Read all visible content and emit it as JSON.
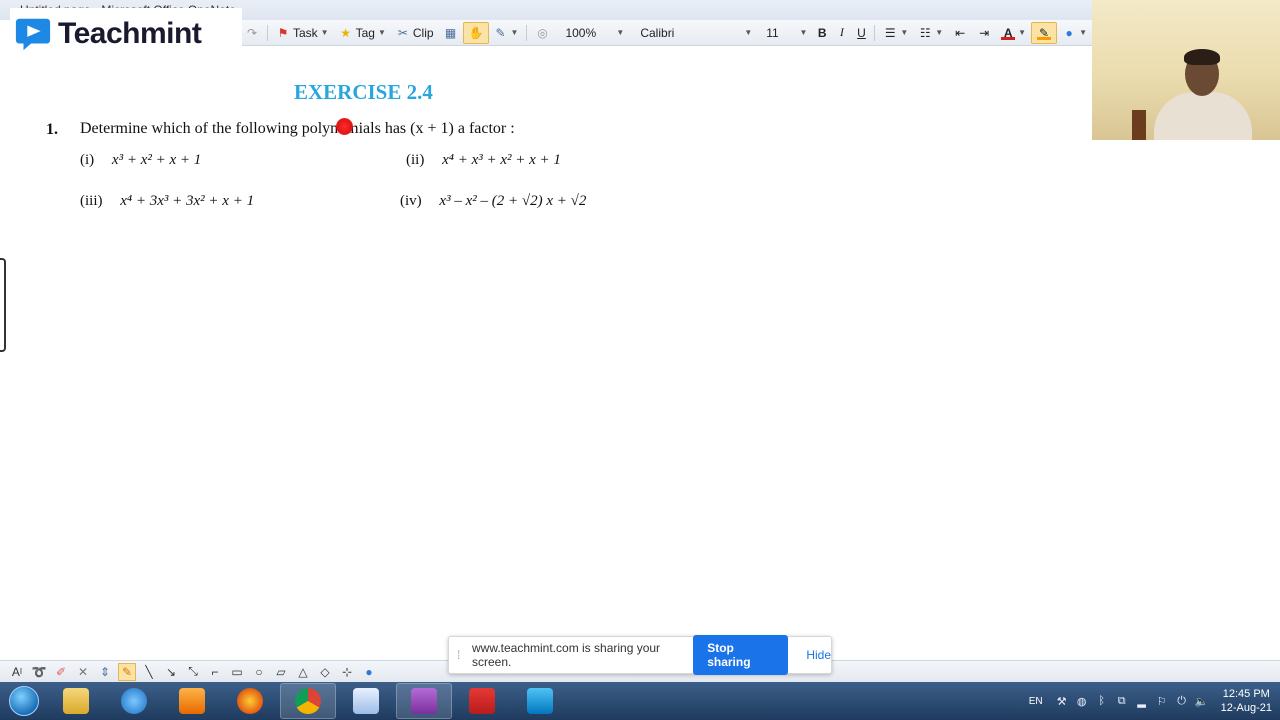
{
  "window": {
    "title": "Untitled page - Microsoft Office OneNote"
  },
  "logo": {
    "text": "Teachmint"
  },
  "toolbar": {
    "task_label": "Task",
    "tag_label": "Tag",
    "clip_label": "Clip",
    "zoom": "100%",
    "font_name": "Calibri",
    "font_size": "11",
    "bold": "B",
    "italic": "I",
    "underline": "U"
  },
  "content": {
    "exercise_title": "EXERCISE 2.4",
    "question_number": "1.",
    "question_text": "Determine which of the following polynomials has (x + 1) a factor :",
    "options": [
      {
        "label": "(i)",
        "expression": "x³ + x² + x + 1"
      },
      {
        "label": "(ii)",
        "expression": "x⁴ + x³ + x² + x + 1"
      },
      {
        "label": "(iii)",
        "expression": "x⁴ + 3x³ + 3x² + x + 1"
      },
      {
        "label": "(iv)",
        "expression": "x³ – x² – (2 + √2) x + √2"
      }
    ]
  },
  "share_banner": {
    "message": "www.teachmint.com is sharing your screen.",
    "stop_label": "Stop sharing",
    "hide_label": "Hide"
  },
  "taskbar": {
    "language": "EN",
    "time": "12:45 PM",
    "date": "12-Aug-21"
  },
  "colors": {
    "exercise_title": "#2aa6df",
    "laser_pointer": "#e01515",
    "stop_button": "#1a73e8",
    "taskbar": "#1f3b5e"
  }
}
